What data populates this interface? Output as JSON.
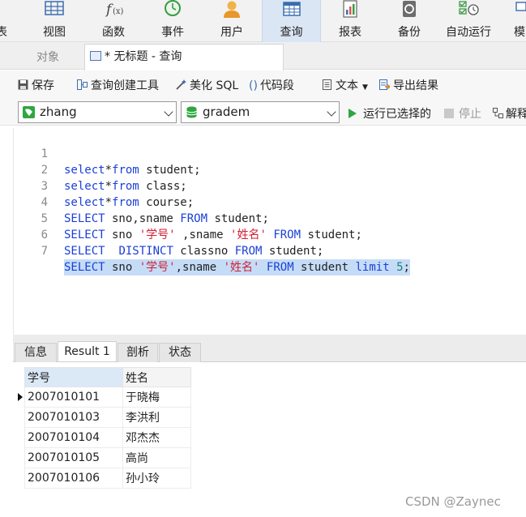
{
  "ribbon": {
    "partial_left": "表",
    "items": [
      {
        "label": "视图",
        "icon": "view-icon"
      },
      {
        "label": "函数",
        "icon": "function-icon"
      },
      {
        "label": "事件",
        "icon": "event-clock-icon"
      },
      {
        "label": "用户",
        "icon": "user-icon"
      },
      {
        "label": "查询",
        "icon": "query-icon",
        "active": true
      },
      {
        "label": "报表",
        "icon": "report-icon"
      },
      {
        "label": "备份",
        "icon": "backup-icon"
      },
      {
        "label": "自动运行",
        "icon": "automation-icon"
      },
      {
        "label": "模",
        "icon": "model-icon"
      }
    ]
  },
  "tabs": {
    "objects": "对象",
    "query": "* 无标题 - 查询"
  },
  "toolbar": {
    "save": "保存",
    "query_builder": "查询创建工具",
    "beautify": "美化 SQL",
    "code_snippet": "代码段",
    "text": "文本",
    "export": "导出结果"
  },
  "connection": {
    "connection_name": "zhang",
    "database_name": "gradem",
    "run_selected": "运行已选择的",
    "stop": "停止",
    "explain": "解释"
  },
  "editor": {
    "lines": [
      {
        "no": "1",
        "text": "select*from student;"
      },
      {
        "no": "2",
        "text": "select*from class;"
      },
      {
        "no": "3",
        "text": "select*from course;"
      },
      {
        "no": "4",
        "text": "SELECT sno,sname FROM student;"
      },
      {
        "no": "5",
        "text": "SELECT sno '学号' ,sname '姓名' FROM student;"
      },
      {
        "no": "6",
        "text": "SELECT  DISTINCT classno FROM student;"
      },
      {
        "no": "7",
        "text": "SELECT sno '学号',sname '姓名' FROM student limit 5;",
        "selected": true
      }
    ]
  },
  "result_tabs": [
    {
      "label": "信息"
    },
    {
      "label": "Result 1",
      "active": true
    },
    {
      "label": "剖析"
    },
    {
      "label": "状态"
    }
  ],
  "grid": {
    "columns": [
      "学号",
      "姓名"
    ],
    "rows": [
      [
        "2007010101",
        "于晓梅"
      ],
      [
        "2007010103",
        "李洪利"
      ],
      [
        "2007010104",
        "邓杰杰"
      ],
      [
        "2007010105",
        "高尚"
      ],
      [
        "2007010106",
        "孙小玲"
      ]
    ],
    "current_row": 1
  },
  "watermark": "CSDN @Zaynec",
  "colors": {
    "keyword": "#1a3fd8",
    "string": "#d11f35",
    "number": "#1a7f7a",
    "selection": "#c5dcf7",
    "active_ribbon": "#dbe6f4"
  }
}
